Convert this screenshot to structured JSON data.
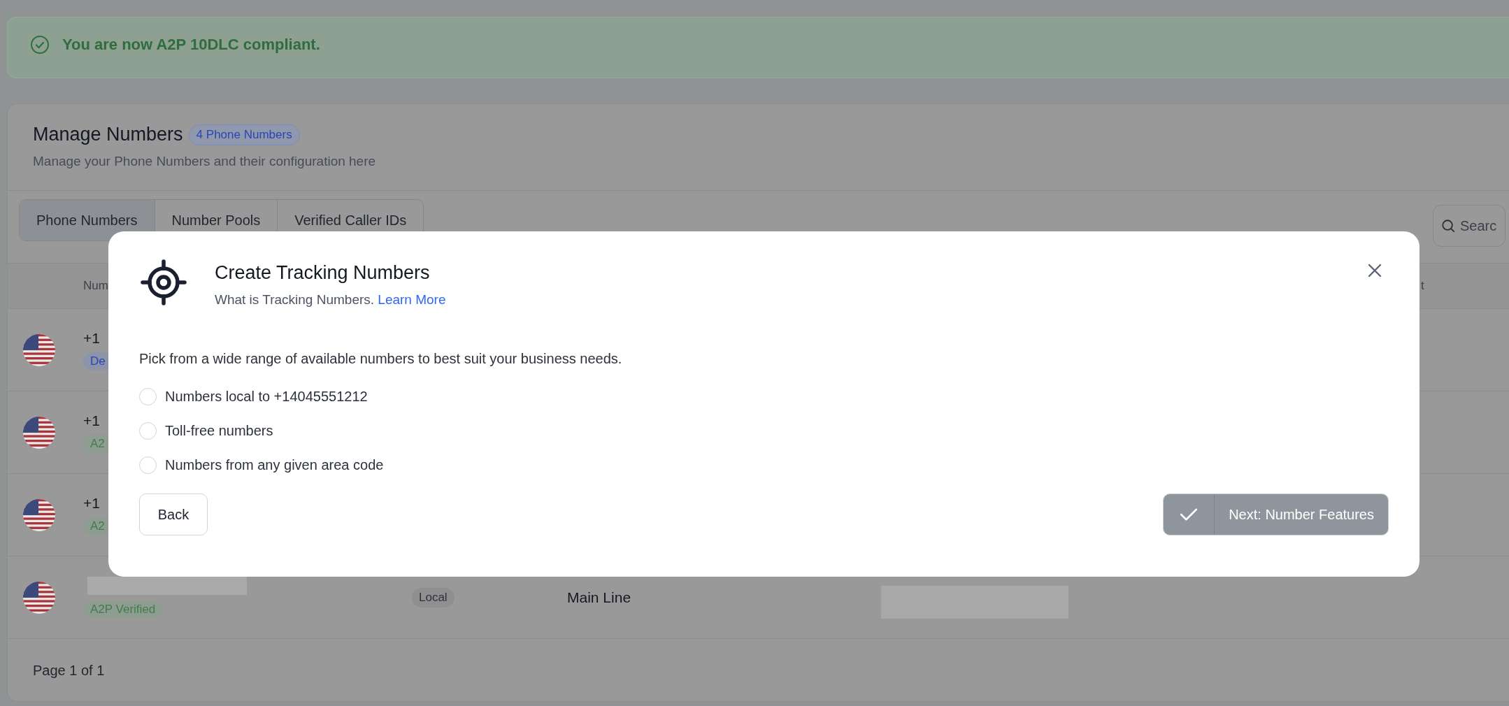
{
  "banner": {
    "text": "You are now A2P 10DLC compliant."
  },
  "card": {
    "title": "Manage Numbers",
    "badge": "4 Phone Numbers",
    "subtitle": "Manage your Phone Numbers and their configuration here"
  },
  "tabs": [
    {
      "label": "Phone Numbers",
      "selected": true
    },
    {
      "label": "Number Pools",
      "selected": false
    },
    {
      "label": "Verified Caller IDs",
      "selected": false
    }
  ],
  "search": {
    "placeholder": "Searc"
  },
  "table": {
    "columns": [
      "Num",
      "t"
    ],
    "rows": [
      {
        "number": "+1",
        "tag": "De",
        "verified": false
      },
      {
        "number": "+1",
        "tag": "A2",
        "verified": true
      },
      {
        "number": "+1",
        "tag": "A2",
        "verified": true
      },
      {
        "tag": "A2P Verified",
        "verified": true,
        "type": "Local",
        "name": "Main Line",
        "redacted": true
      }
    ]
  },
  "pagination": "Page 1 of 1",
  "modal": {
    "title": "Create Tracking Numbers",
    "subtitle": "What is Tracking Numbers.",
    "link": "Learn More",
    "prompt": "Pick from a wide range of available numbers to best suit your business needs.",
    "options": [
      {
        "label": "Numbers local to +14045551212",
        "selected": false
      },
      {
        "label": "Toll-free numbers",
        "selected": false
      },
      {
        "label": "Numbers from any given area code",
        "selected": false
      }
    ],
    "back": "Back",
    "next": "Next: Number Features"
  }
}
